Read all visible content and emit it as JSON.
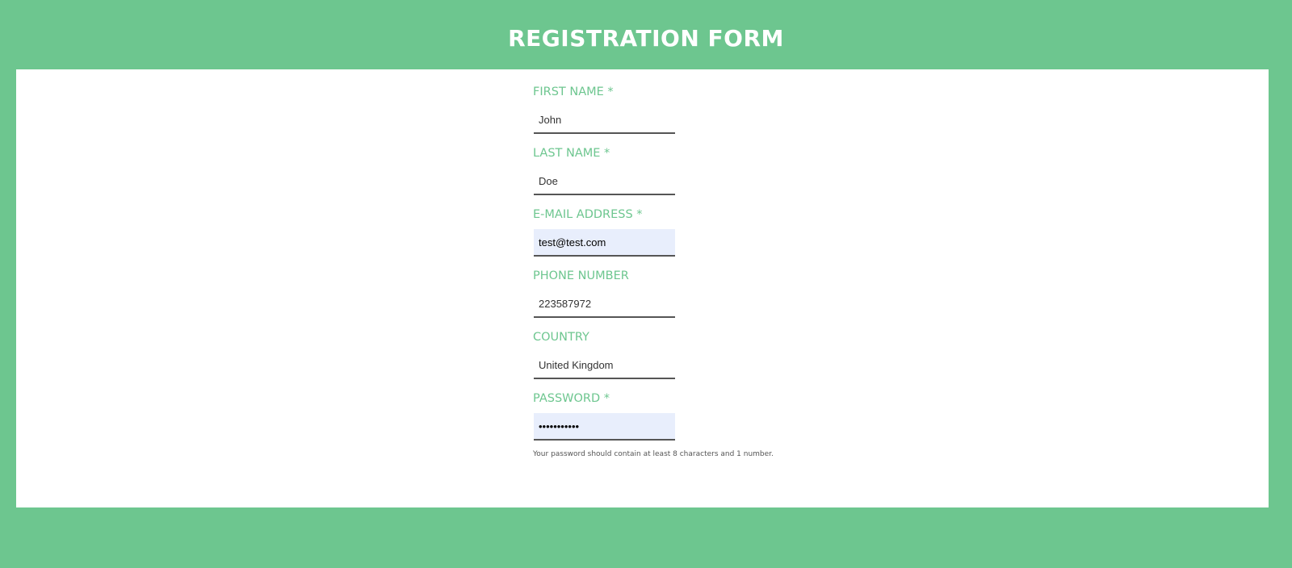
{
  "header": {
    "title": "REGISTRATION FORM"
  },
  "colors": {
    "brand_green": "#6dc68f",
    "autofill_bg": "#e8eefc",
    "panel_bg": "#ffffff"
  },
  "form": {
    "fields": [
      {
        "label": "FIRST NAME *",
        "value": "John",
        "type": "text",
        "autofilled": false
      },
      {
        "label": "LAST NAME *",
        "value": "Doe",
        "type": "text",
        "autofilled": false
      },
      {
        "label": "E-MAIL ADDRESS *",
        "value": "test@test.com",
        "type": "email",
        "autofilled": true
      },
      {
        "label": "PHONE NUMBER",
        "value": "223587972",
        "type": "tel",
        "autofilled": false
      },
      {
        "label": "COUNTRY",
        "value": "United Kingdom",
        "type": "text",
        "autofilled": false
      },
      {
        "label": "PASSWORD *",
        "value": "•••••••••••",
        "type": "password",
        "autofilled": true
      }
    ],
    "password_hint": "Your password should contain at least 8 characters and 1 number."
  }
}
